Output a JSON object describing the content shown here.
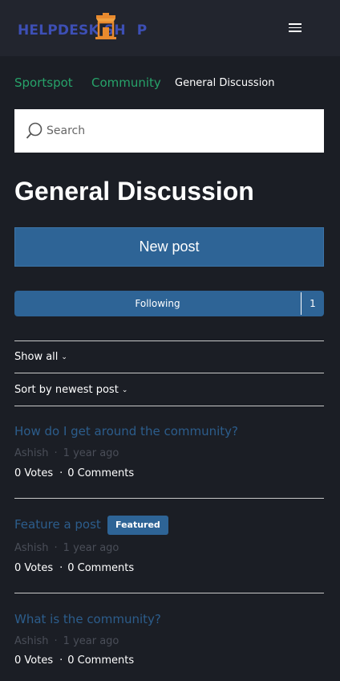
{
  "header": {
    "logo_text_left": "HELPDESK",
    "logo_text_right": "SH",
    "logo_text_end": "P",
    "logo_color": "#3d4fb5",
    "logo_icon_color": "#e88a2e",
    "menu_icon": "hamburger-icon"
  },
  "breadcrumb": {
    "items": [
      "Sportspot",
      "Community"
    ],
    "current": "General Discussion",
    "link_color": "#27a36a"
  },
  "search": {
    "placeholder": "Search",
    "value": "",
    "icon": "search-icon"
  },
  "page": {
    "title": "General Discussion"
  },
  "actions": {
    "new_post_label": "New post",
    "following_label": "Following",
    "following_count": "1",
    "button_color": "#2e6496"
  },
  "filters": {
    "show_label": "Show all",
    "sort_label": "Sort by newest post"
  },
  "posts": [
    {
      "title": "How do I get around the community?",
      "author": "Ashish",
      "time": "1 year ago",
      "votes": "0 Votes",
      "comments": "0 Comments",
      "badge": ""
    },
    {
      "title": "Feature a post",
      "author": "Ashish",
      "time": "1 year ago",
      "votes": "0 Votes",
      "comments": "0 Comments",
      "badge": "Featured"
    },
    {
      "title": "What is the community?",
      "author": "Ashish",
      "time": "1 year ago",
      "votes": "0 Votes",
      "comments": "0 Comments",
      "badge": ""
    }
  ],
  "colors": {
    "background": "#1b1e25",
    "header_bg": "#22252e",
    "post_title": "#2c5d8c",
    "meta": "#4a4e58"
  }
}
